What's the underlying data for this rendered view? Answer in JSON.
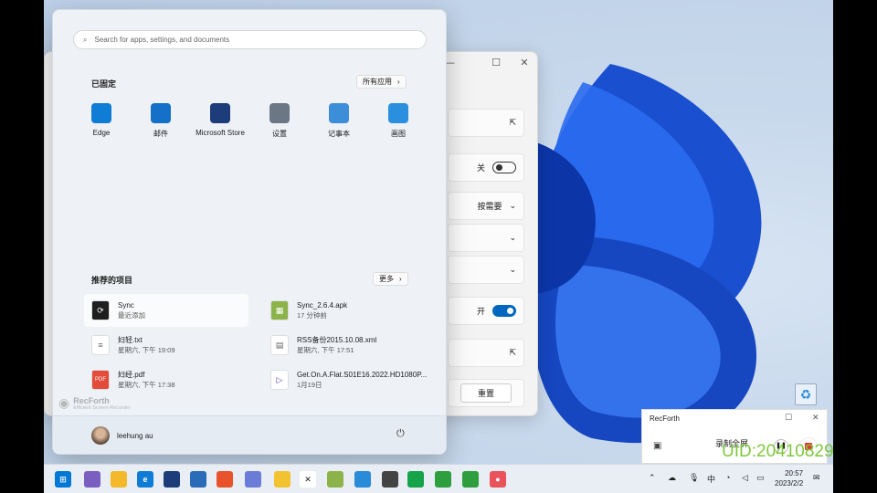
{
  "search": {
    "placeholder": "Search for apps, settings, and documents"
  },
  "pinned": {
    "title": "已固定",
    "all_apps": "所有应用",
    "apps": [
      {
        "label": "Edge",
        "icon": "edge-icon",
        "color": "#0f7cd6"
      },
      {
        "label": "邮件",
        "icon": "mail-icon",
        "color": "#1570c7"
      },
      {
        "label": "Microsoft Store",
        "icon": "store-icon",
        "color": "#1c3d7a"
      },
      {
        "label": "设置",
        "icon": "gear-icon",
        "color": "#6b7785"
      },
      {
        "label": "记事本",
        "icon": "notepad-icon",
        "color": "#3d8ed9"
      },
      {
        "label": "画图",
        "icon": "paint-icon",
        "color": "#2b8fe0"
      }
    ]
  },
  "recommended": {
    "title": "推荐的项目",
    "more": "更多",
    "items": [
      {
        "name": "Sync",
        "sub": "最近添加",
        "icon": "sync-icon"
      },
      {
        "name": "Sync_2.6.4.apk",
        "sub": "17 分钟前",
        "icon": "apk-icon"
      },
      {
        "name": "妇轻.txt",
        "sub": "星期六, 下午 19:09",
        "icon": "text-file-icon"
      },
      {
        "name": "RSS备份2015.10.08.xml",
        "sub": "星期六, 下午 17:51",
        "icon": "xml-file-icon"
      },
      {
        "name": "妇经.pdf",
        "sub": "星期六, 下午 17:38",
        "icon": "pdf-icon"
      },
      {
        "name": "Get.On.A.Flat.S01E16.2022.HD1080P...",
        "sub": "1月19日",
        "icon": "video-icon"
      }
    ]
  },
  "watermark": {
    "brand": "RecForth",
    "sub": "Efficient Screen Recorder"
  },
  "user": {
    "name": "leehung au"
  },
  "settings_window": {
    "toggle_off": "关",
    "dropdown_value": "按需要",
    "toggle_on": "开",
    "button": "重置"
  },
  "recorder": {
    "title": "RecForth",
    "mode": "录制全屏"
  },
  "uid": "UID:20410829",
  "tray": {
    "ime": "中",
    "time": "20:57",
    "date": "2023/2/2"
  },
  "colors": {
    "accent": "#0067c0",
    "uid_green": "#7ec83c"
  }
}
